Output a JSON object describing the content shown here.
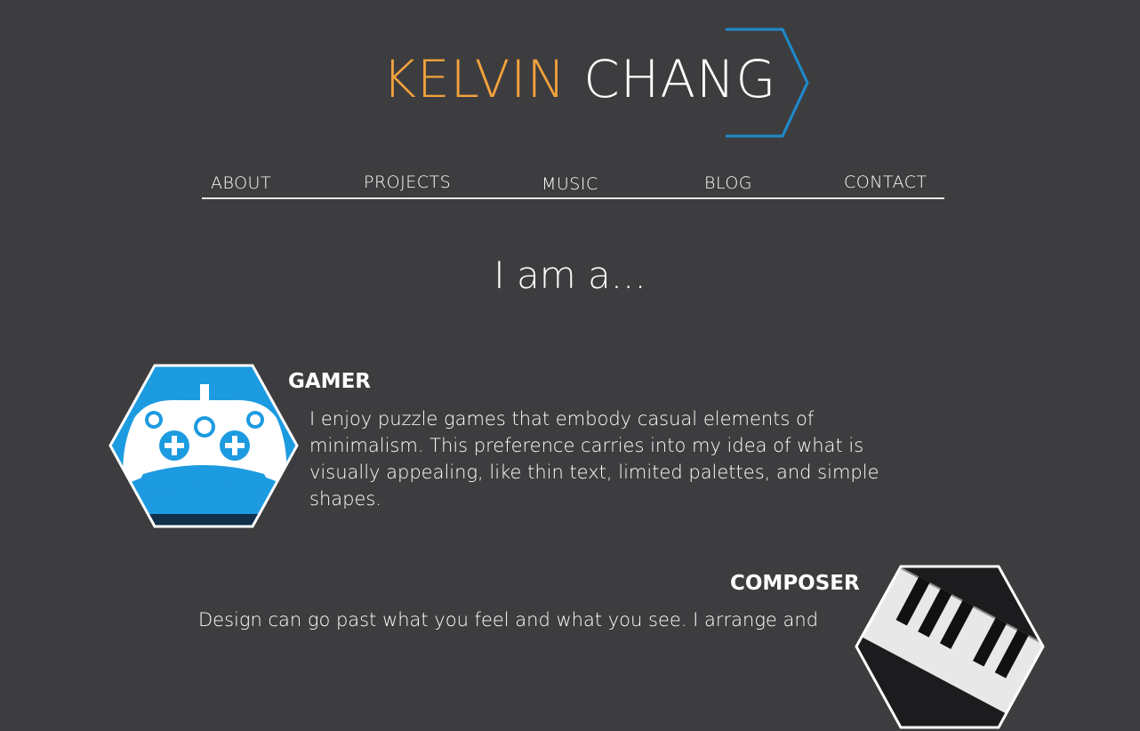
{
  "logo": {
    "first": "KELVIN",
    "last": "CHANG"
  },
  "nav": [
    {
      "label": "ABOUT"
    },
    {
      "label": "PROJECTS"
    },
    {
      "label": "MUSIC"
    },
    {
      "label": "BLOG"
    },
    {
      "label": "CONTACT"
    }
  ],
  "headline": "I am a...",
  "roles": [
    {
      "title": "GAMER",
      "description": "I enjoy puzzle games that embody casual elements of minimalism. This preference carries into my idea of what is visually appealing, like thin text, limited palettes, and simple shapes.",
      "image_icon": "game-controller-icon"
    },
    {
      "title": "COMPOSER",
      "description": "Design can go past what you feel and what you see. I arrange and",
      "image_icon": "piano-keys-icon"
    }
  ],
  "colors": {
    "background": "#3d3d3f",
    "accent_orange": "#f2a23c",
    "accent_blue": "#1e8bcc",
    "controller_blue": "#1d9be0"
  }
}
